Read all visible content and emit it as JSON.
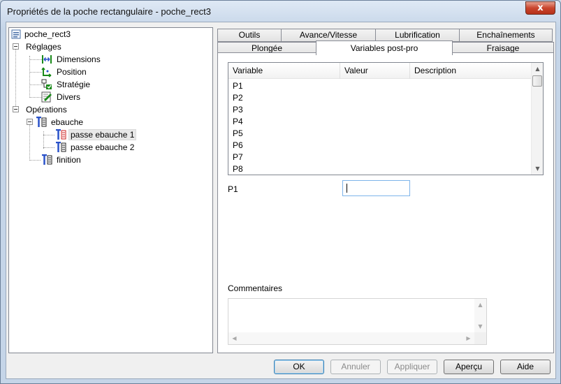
{
  "window": {
    "title": "Propriétés de la poche rectangulaire - poche_rect3",
    "close_symbol": "x"
  },
  "tree": {
    "root": "poche_rect3",
    "reglages": "Réglages",
    "dimensions": "Dimensions",
    "position": "Position",
    "strategie": "Stratégie",
    "divers": "Divers",
    "operations": "Opérations",
    "ebauche": "ebauche",
    "passe1": "passe ebauche 1",
    "passe2": "passe ebauche 2",
    "finition": "finition"
  },
  "tabs": {
    "row1": [
      "Outils",
      "Avance/Vitesse",
      "Lubrification",
      "Enchaînements"
    ],
    "row2": [
      "Plongée",
      "Variables post-pro",
      "Fraisage"
    ],
    "active": "Variables post-pro"
  },
  "variables": {
    "columns": [
      "Variable",
      "Valeur",
      "Description"
    ],
    "rows": [
      "P1",
      "P2",
      "P3",
      "P4",
      "P5",
      "P6",
      "P7",
      "P8"
    ],
    "selected_label": "P1",
    "selected_value": "",
    "comments_label": "Commentaires",
    "comments_value": ""
  },
  "buttons": {
    "ok": "OK",
    "annuler": "Annuler",
    "appliquer": "Appliquer",
    "apercu": "Aperçu",
    "aide": "Aide"
  },
  "colors": {
    "accent_blue": "#3c7fb1",
    "icon_blue": "#2a52c9",
    "icon_green": "#1a8a1a",
    "icon_red": "#cc2222"
  }
}
